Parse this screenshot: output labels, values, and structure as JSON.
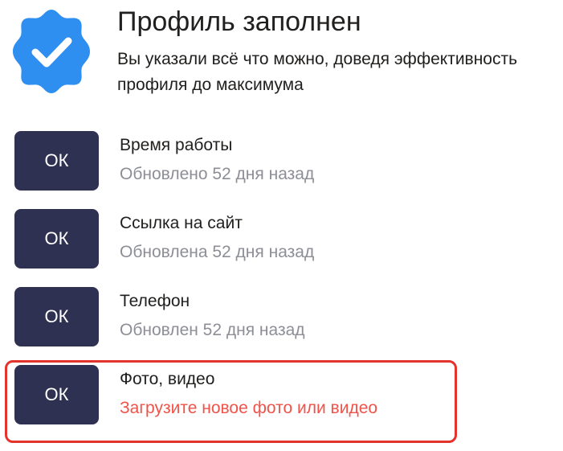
{
  "header": {
    "icon": "verified-check-badge-icon",
    "title": "Профиль заполнен",
    "subtitle": "Вы указали всё что можно, доведя эффективность профиля до максимума"
  },
  "items": [
    {
      "button_label": "ОК",
      "title": "Время работы",
      "status": "Обновлено 52 дня назад"
    },
    {
      "button_label": "ОК",
      "title": "Ссылка на сайт",
      "status": "Обновлена 52 дня назад"
    },
    {
      "button_label": "ОК",
      "title": "Телефон",
      "status": "Обновлен 52 дня назад"
    },
    {
      "button_label": "ОК",
      "title": "Фото, видео",
      "status": "Загрузите новое фото или видео"
    }
  ],
  "colors": {
    "badge_blue": "#2f8ff0",
    "button_bg": "#2f3152",
    "status_gray": "#8d8e96",
    "alert_red": "#f0534a",
    "highlight_frame": "#e2332c"
  }
}
